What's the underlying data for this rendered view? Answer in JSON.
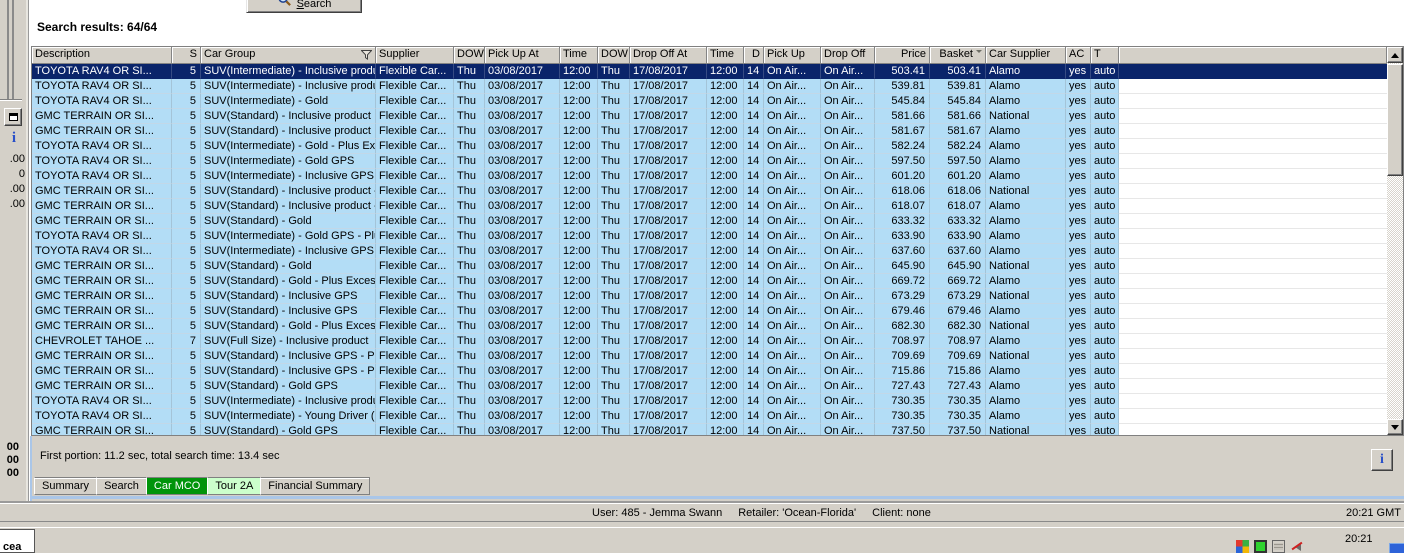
{
  "window": {
    "search_button_label": "Search",
    "results_label": "Search results: 64/64",
    "footer_status": "First portion: 11.2 sec, total search time: 13.4 sec"
  },
  "table": {
    "columns": [
      "Description",
      "S",
      "Car Group",
      "Supplier",
      "DOW",
      "Pick Up At",
      "Time",
      "DOW",
      "Drop Off At",
      "Time",
      "D",
      "Pick Up",
      "Drop Off",
      "Price",
      "Basket",
      "Car Supplier",
      "AC",
      "T"
    ],
    "row_defaults": {
      "supplier": "Flexible Car...",
      "dow1": "Thu",
      "pickup_at": "03/08/2017",
      "time1": "12:00",
      "dow2": "Thu",
      "dropoff_at": "17/08/2017",
      "time2": "12:00",
      "d": "14",
      "pickup_loc": "On Air...",
      "dropoff_loc": "On Air...",
      "ac": "yes",
      "t": "auto"
    },
    "rows": [
      {
        "description": "TOYOTA RAV4 OR SI...",
        "s": "5",
        "car_group": "SUV(Intermediate) - Inclusive product",
        "price": "503.41",
        "basket": "503.41",
        "car_supplier": "Alamo",
        "selected": true
      },
      {
        "description": "TOYOTA RAV4 OR SI...",
        "s": "5",
        "car_group": "SUV(Intermediate) - Inclusive product...",
        "price": "539.81",
        "basket": "539.81",
        "car_supplier": "Alamo"
      },
      {
        "description": "TOYOTA RAV4 OR SI...",
        "s": "5",
        "car_group": "SUV(Intermediate) - Gold",
        "price": "545.84",
        "basket": "545.84",
        "car_supplier": "Alamo"
      },
      {
        "description": "GMC TERRAIN OR SI...",
        "s": "5",
        "car_group": "SUV(Standard) - Inclusive product",
        "price": "581.66",
        "basket": "581.66",
        "car_supplier": "National"
      },
      {
        "description": "GMC TERRAIN OR SI...",
        "s": "5",
        "car_group": "SUV(Standard) - Inclusive product",
        "price": "581.67",
        "basket": "581.67",
        "car_supplier": "Alamo"
      },
      {
        "description": "TOYOTA RAV4 OR SI...",
        "s": "5",
        "car_group": "SUV(Intermediate) - Gold - Plus Exces...",
        "price": "582.24",
        "basket": "582.24",
        "car_supplier": "Alamo"
      },
      {
        "description": "TOYOTA RAV4 OR SI...",
        "s": "5",
        "car_group": "SUV(Intermediate) - Gold GPS",
        "price": "597.50",
        "basket": "597.50",
        "car_supplier": "Alamo"
      },
      {
        "description": "TOYOTA RAV4 OR SI...",
        "s": "5",
        "car_group": "SUV(Intermediate) - Inclusive GPS",
        "price": "601.20",
        "basket": "601.20",
        "car_supplier": "Alamo"
      },
      {
        "description": "GMC TERRAIN OR SI...",
        "s": "5",
        "car_group": "SUV(Standard) - Inclusive product - Pl...",
        "price": "618.06",
        "basket": "618.06",
        "car_supplier": "National"
      },
      {
        "description": "GMC TERRAIN OR SI...",
        "s": "5",
        "car_group": "SUV(Standard) - Inclusive product - Pl...",
        "price": "618.07",
        "basket": "618.07",
        "car_supplier": "Alamo"
      },
      {
        "description": "GMC TERRAIN OR SI...",
        "s": "5",
        "car_group": "SUV(Standard) - Gold",
        "price": "633.32",
        "basket": "633.32",
        "car_supplier": "Alamo"
      },
      {
        "description": "TOYOTA RAV4 OR SI...",
        "s": "5",
        "car_group": "SUV(Intermediate) - Gold GPS - Plus E...",
        "price": "633.90",
        "basket": "633.90",
        "car_supplier": "Alamo"
      },
      {
        "description": "TOYOTA RAV4 OR SI...",
        "s": "5",
        "car_group": "SUV(Intermediate) - Inclusive GPS - Pl...",
        "price": "637.60",
        "basket": "637.60",
        "car_supplier": "Alamo"
      },
      {
        "description": "GMC TERRAIN OR SI...",
        "s": "5",
        "car_group": "SUV(Standard) - Gold",
        "price": "645.90",
        "basket": "645.90",
        "car_supplier": "National"
      },
      {
        "description": "GMC TERRAIN OR SI...",
        "s": "5",
        "car_group": "SUV(Standard) - Gold - Plus Excess R...",
        "price": "669.72",
        "basket": "669.72",
        "car_supplier": "Alamo"
      },
      {
        "description": "GMC TERRAIN OR SI...",
        "s": "5",
        "car_group": "SUV(Standard) - Inclusive GPS",
        "price": "673.29",
        "basket": "673.29",
        "car_supplier": "National"
      },
      {
        "description": "GMC TERRAIN OR SI...",
        "s": "5",
        "car_group": "SUV(Standard) - Inclusive GPS",
        "price": "679.46",
        "basket": "679.46",
        "car_supplier": "Alamo"
      },
      {
        "description": "GMC TERRAIN OR SI...",
        "s": "5",
        "car_group": "SUV(Standard) - Gold - Plus Excess R...",
        "price": "682.30",
        "basket": "682.30",
        "car_supplier": "National"
      },
      {
        "description": "CHEVROLET TAHOE ...",
        "s": "7",
        "car_group": "SUV(Full Size) - Inclusive product",
        "price": "708.97",
        "basket": "708.97",
        "car_supplier": "Alamo"
      },
      {
        "description": "GMC TERRAIN OR SI...",
        "s": "5",
        "car_group": "SUV(Standard) - Inclusive GPS - Plus ...",
        "price": "709.69",
        "basket": "709.69",
        "car_supplier": "National"
      },
      {
        "description": "GMC TERRAIN OR SI...",
        "s": "5",
        "car_group": "SUV(Standard) - Inclusive GPS - Plus ...",
        "price": "715.86",
        "basket": "715.86",
        "car_supplier": "Alamo"
      },
      {
        "description": "GMC TERRAIN OR SI...",
        "s": "5",
        "car_group": "SUV(Standard) - Gold GPS",
        "price": "727.43",
        "basket": "727.43",
        "car_supplier": "Alamo"
      },
      {
        "description": "TOYOTA RAV4 OR SI...",
        "s": "5",
        "car_group": "SUV(Intermediate) - Inclusive product",
        "price": "730.35",
        "basket": "730.35",
        "car_supplier": "Alamo"
      },
      {
        "description": "TOYOTA RAV4 OR SI...",
        "s": "5",
        "car_group": "SUV(Intermediate) - Young Driver (ag...",
        "price": "730.35",
        "basket": "730.35",
        "car_supplier": "Alamo"
      },
      {
        "description": "GMC TERRAIN OR SI...",
        "s": "5",
        "car_group": "SUV(Standard) - Gold GPS",
        "price": "737.50",
        "basket": "737.50",
        "car_supplier": "National"
      }
    ]
  },
  "tabs": [
    {
      "label": "Summary"
    },
    {
      "label": "Search"
    },
    {
      "label": "Car MCO",
      "style": "active"
    },
    {
      "label": "Tour 2A",
      "style": "highlight"
    },
    {
      "label": "Financial Summary"
    }
  ],
  "status_bar": {
    "user": "User: 485 - Jemma Swann",
    "retailer": "Retailer: 'Ocean-Florida'",
    "client": "Client: none",
    "time": "20:21 GMT"
  },
  "taskbar": {
    "left_fragment": "cea",
    "clock": "20:21",
    "tray_icons": [
      "windows-colored-icon",
      "display-icon",
      "clipboard-icon",
      "volume-muted-icon"
    ]
  },
  "left_panel_fragments": {
    "values_top": [
      ".00",
      "0",
      ".00",
      ".00"
    ],
    "values_bottom": [
      "00",
      "00",
      "00"
    ]
  },
  "colors": {
    "selection": "#0a246a",
    "row_blue": "#b3ddf6",
    "active_tab_green": "#00940a",
    "tour_tab_green": "#ccffcc",
    "chrome_grey": "#d4d0c8"
  }
}
